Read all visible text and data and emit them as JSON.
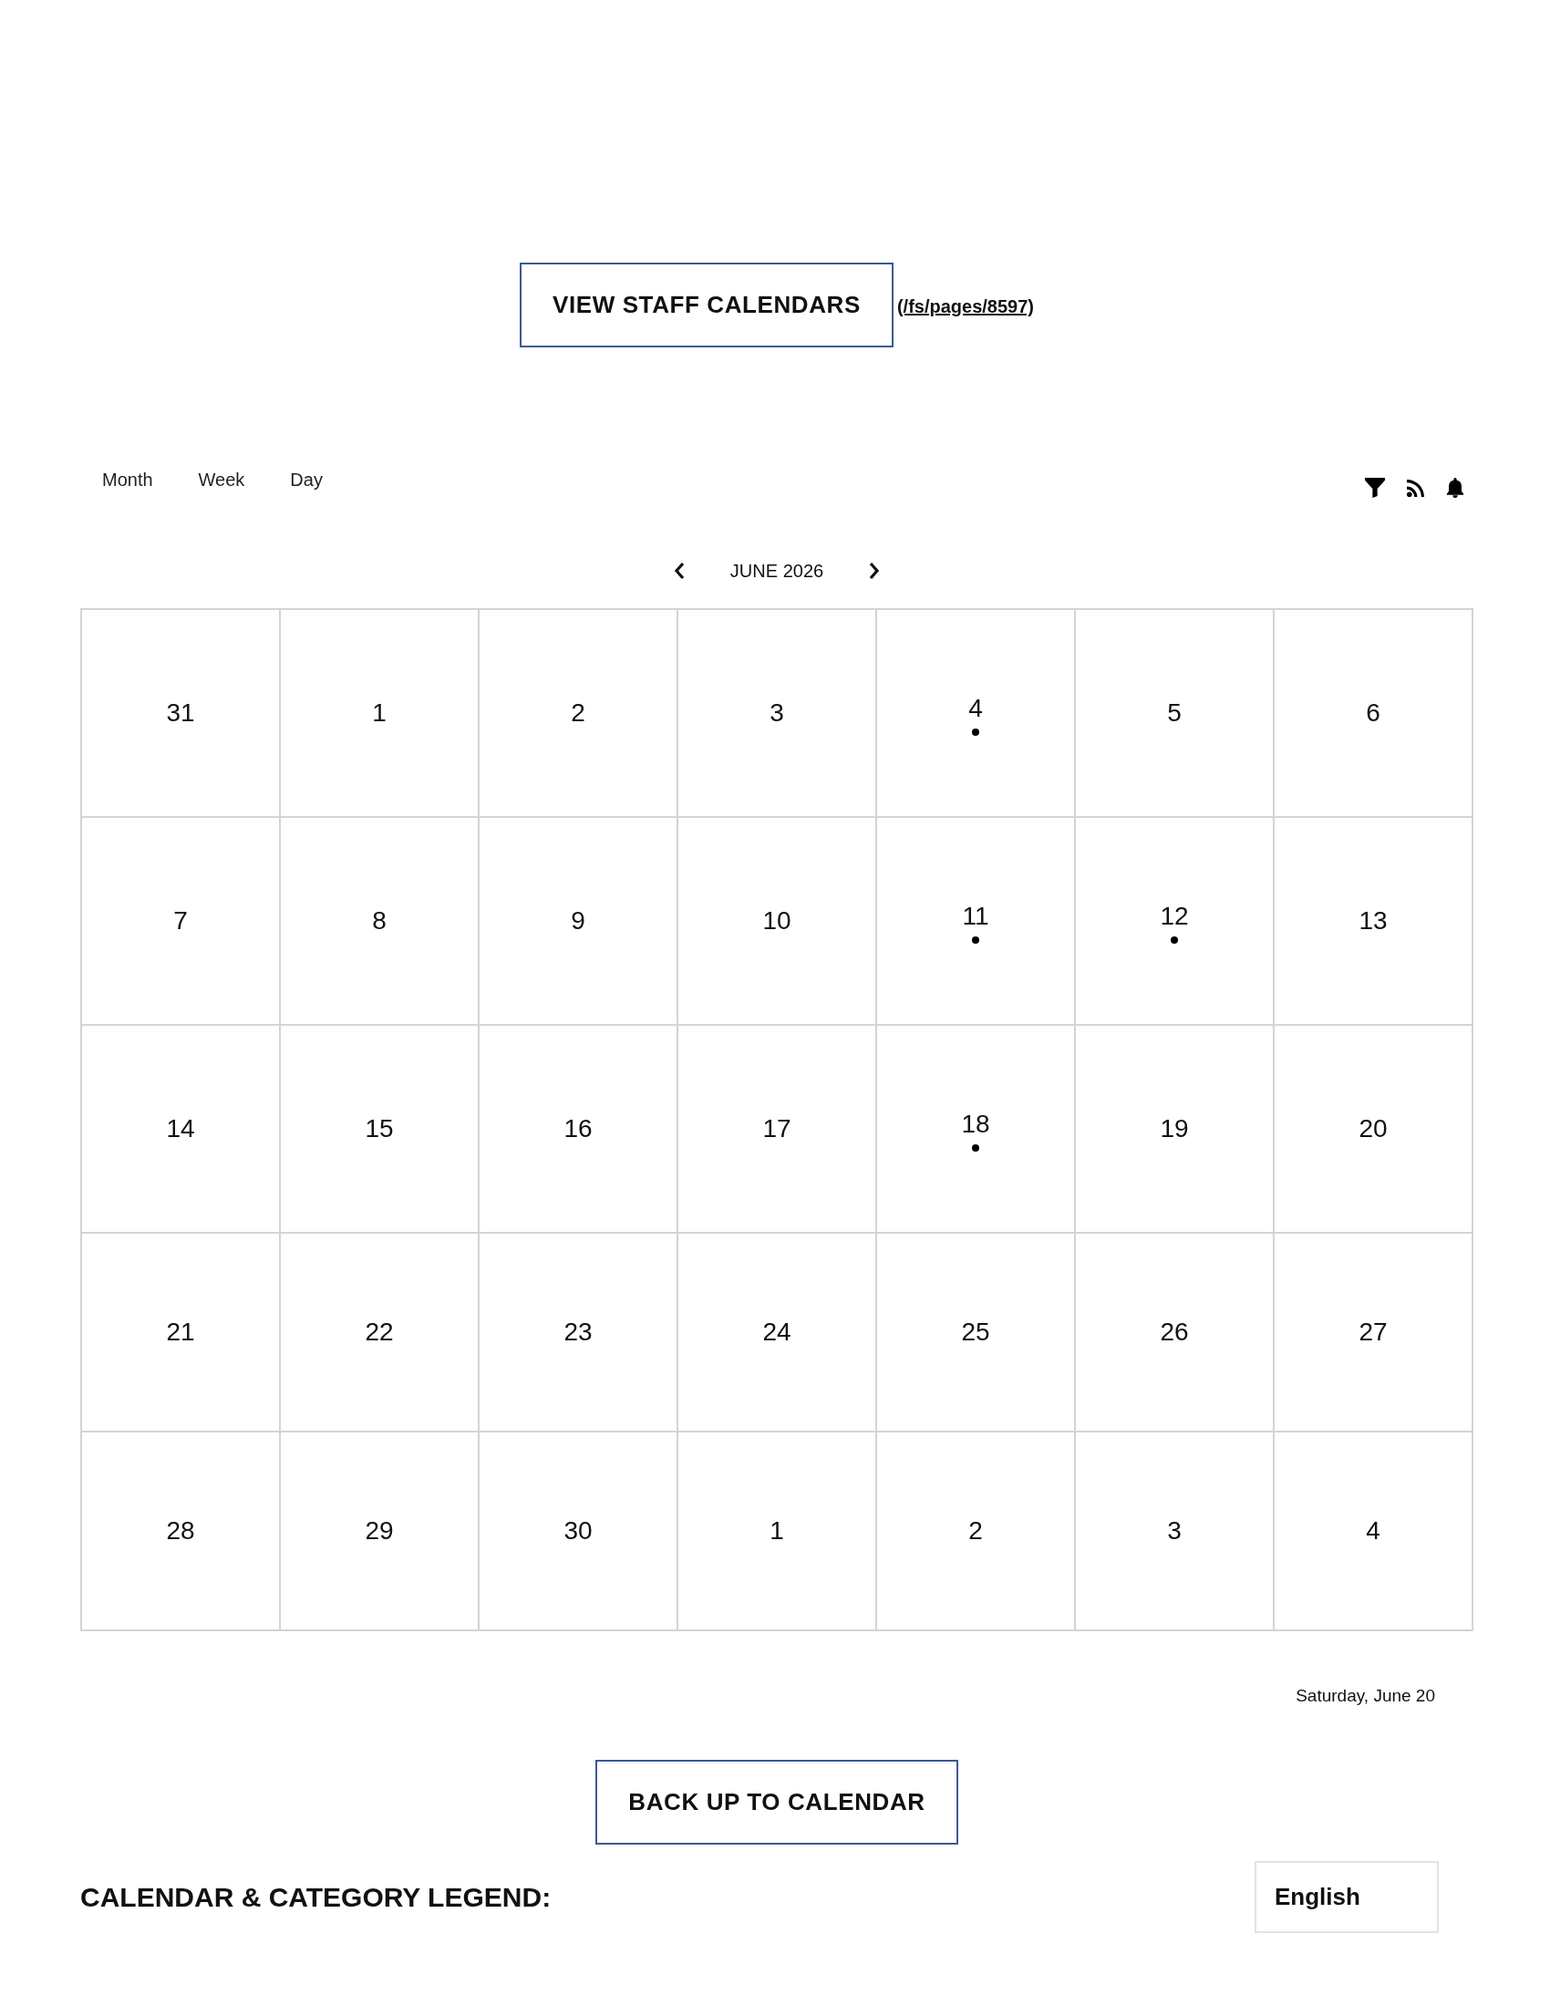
{
  "staff": {
    "button": "VIEW STAFF CALENDARS",
    "link": "(/fs/pages/8597)"
  },
  "view_tabs": [
    {
      "label": "Month"
    },
    {
      "label": "Week"
    },
    {
      "label": "Day"
    }
  ],
  "month_nav": {
    "label": "JUNE 2026"
  },
  "calendar": {
    "weeks": [
      {
        "days": [
          {
            "day": "31",
            "event": false
          },
          {
            "day": "1",
            "event": false
          },
          {
            "day": "2",
            "event": false
          },
          {
            "day": "3",
            "event": false
          },
          {
            "day": "4",
            "event": true
          },
          {
            "day": "5",
            "event": false
          },
          {
            "day": "6",
            "event": false
          }
        ]
      },
      {
        "days": [
          {
            "day": "7",
            "event": false
          },
          {
            "day": "8",
            "event": false
          },
          {
            "day": "9",
            "event": false
          },
          {
            "day": "10",
            "event": false
          },
          {
            "day": "11",
            "event": true
          },
          {
            "day": "12",
            "event": true
          },
          {
            "day": "13",
            "event": false
          }
        ]
      },
      {
        "days": [
          {
            "day": "14",
            "event": false
          },
          {
            "day": "15",
            "event": false
          },
          {
            "day": "16",
            "event": false
          },
          {
            "day": "17",
            "event": false
          },
          {
            "day": "18",
            "event": true
          },
          {
            "day": "19",
            "event": false
          },
          {
            "day": "20",
            "event": false
          }
        ]
      },
      {
        "days": [
          {
            "day": "21",
            "event": false
          },
          {
            "day": "22",
            "event": false
          },
          {
            "day": "23",
            "event": false
          },
          {
            "day": "24",
            "event": false
          },
          {
            "day": "25",
            "event": false
          },
          {
            "day": "26",
            "event": false
          },
          {
            "day": "27",
            "event": false
          }
        ]
      },
      {
        "days": [
          {
            "day": "28",
            "event": false
          },
          {
            "day": "29",
            "event": false
          },
          {
            "day": "30",
            "event": false
          },
          {
            "day": "1",
            "event": false
          },
          {
            "day": "2",
            "event": false
          },
          {
            "day": "3",
            "event": false
          },
          {
            "day": "4",
            "event": false
          }
        ]
      }
    ]
  },
  "selected_date": "Saturday, June 20",
  "back_button": "BACK UP TO CALENDAR",
  "legend": {
    "heading": "CALENDAR & CATEGORY LEGEND:"
  },
  "language_select": {
    "value": "English"
  }
}
